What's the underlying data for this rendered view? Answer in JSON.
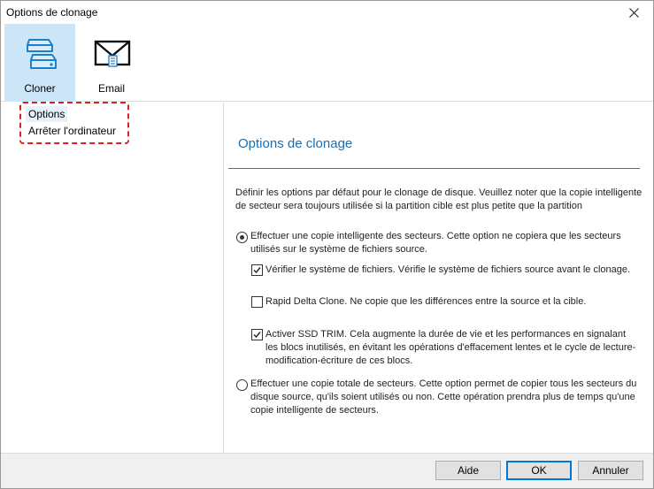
{
  "window": {
    "title": "Options de clonage"
  },
  "toolbar": {
    "items": [
      {
        "label": "Cloner",
        "icon": "disk-stack-icon",
        "active": true
      },
      {
        "label": "Email",
        "icon": "envelope-icon",
        "active": false
      }
    ]
  },
  "sidebar": {
    "items": [
      {
        "label": "Options",
        "selected": true
      },
      {
        "label": "Arrêter l'ordinateur",
        "selected": false
      }
    ],
    "annotation_color": "#e02020"
  },
  "main": {
    "title": "Options de clonage",
    "intro": "Définir les options par défaut pour le clonage de disque.  Veuillez noter que la copie intelligente de secteur sera toujours utilisée si la partition cible est plus petite que la partition",
    "options": {
      "smart_copy": {
        "text": "Effectuer une copie intelligente des secteurs.  Cette option ne copiera que les secteurs utilisés sur le système de fichiers source.",
        "selected": true
      },
      "verify_fs": {
        "text": "Vérifier le système de fichiers.  Vérifie le système de fichiers source avant le clonage.",
        "checked": true
      },
      "rapid_delta": {
        "text": "Rapid Delta Clone. Ne copie que les différences entre la source et la cible.",
        "checked": false
      },
      "ssd_trim": {
        "text": "Activer SSD TRIM. Cela augmente la durée de vie et les performances en signalant les blocs inutilisés, en évitant les opérations d'effacement lentes et le cycle de lecture-modification-écriture de ces blocs.",
        "checked": true
      },
      "full_copy": {
        "text": "Effectuer une copie totale de secteurs. Cette option permet de copier tous les secteurs du disque source, qu'ils soient utilisés ou non.  Cette opération prendra plus de temps qu'une copie intelligente de secteurs.",
        "selected": false
      }
    }
  },
  "buttons": {
    "help": "Aide",
    "ok": "OK",
    "cancel": "Annuler"
  },
  "colors": {
    "accent": "#1a6fb0",
    "active_tool": "#cde6f7",
    "selected_item": "#e5f1fb"
  }
}
